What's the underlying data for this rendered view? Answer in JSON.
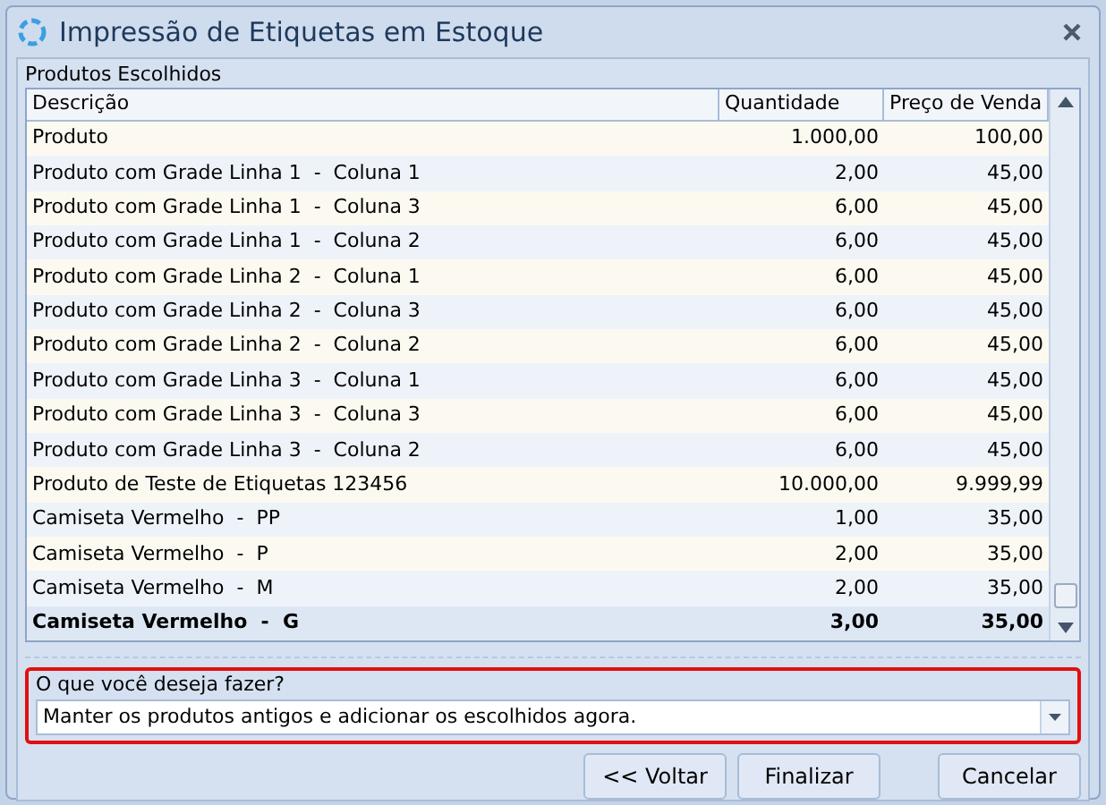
{
  "window": {
    "title": "Impressão de Etiquetas em Estoque"
  },
  "group": {
    "title": "Produtos Escolhidos"
  },
  "table": {
    "columns": [
      "Descrição",
      "Quantidade",
      "Preço de Venda"
    ],
    "rows": [
      {
        "cells": [
          "Produto",
          "1.000,00",
          "100,00"
        ],
        "selected": false
      },
      {
        "cells": [
          "Produto com Grade Linha 1  -  Coluna 1",
          "2,00",
          "45,00"
        ],
        "selected": false
      },
      {
        "cells": [
          "Produto com Grade Linha 1  -  Coluna 3",
          "6,00",
          "45,00"
        ],
        "selected": false
      },
      {
        "cells": [
          "Produto com Grade Linha 1  -  Coluna 2",
          "6,00",
          "45,00"
        ],
        "selected": false
      },
      {
        "cells": [
          "Produto com Grade Linha 2  -  Coluna 1",
          "6,00",
          "45,00"
        ],
        "selected": false
      },
      {
        "cells": [
          "Produto com Grade Linha 2  -  Coluna 3",
          "6,00",
          "45,00"
        ],
        "selected": false
      },
      {
        "cells": [
          "Produto com Grade Linha 2  -  Coluna 2",
          "6,00",
          "45,00"
        ],
        "selected": false
      },
      {
        "cells": [
          "Produto com Grade Linha 3  -  Coluna 1",
          "6,00",
          "45,00"
        ],
        "selected": false
      },
      {
        "cells": [
          "Produto com Grade Linha 3  -  Coluna 3",
          "6,00",
          "45,00"
        ],
        "selected": false
      },
      {
        "cells": [
          "Produto com Grade Linha 3  -  Coluna 2",
          "6,00",
          "45,00"
        ],
        "selected": false
      },
      {
        "cells": [
          "Produto de Teste de Etiquetas 123456",
          "10.000,00",
          "9.999,99"
        ],
        "selected": false
      },
      {
        "cells": [
          "Camiseta Vermelho  -  PP",
          "1,00",
          "35,00"
        ],
        "selected": false
      },
      {
        "cells": [
          "Camiseta Vermelho  -  P",
          "2,00",
          "35,00"
        ],
        "selected": false
      },
      {
        "cells": [
          "Camiseta Vermelho  -  M",
          "2,00",
          "35,00"
        ],
        "selected": false
      },
      {
        "cells": [
          "Camiseta Vermelho  -  G",
          "3,00",
          "35,00"
        ],
        "selected": true
      }
    ]
  },
  "action": {
    "label": "O que você deseja fazer?",
    "value": "Manter os produtos antigos e adicionar os escolhidos agora."
  },
  "buttons": [
    "<< Voltar",
    "Finalizar",
    "Cancelar"
  ]
}
